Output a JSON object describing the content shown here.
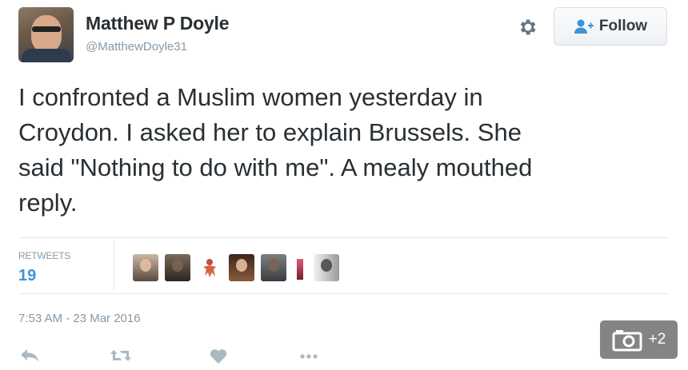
{
  "user": {
    "name": "Matthew P Doyle",
    "handle": "@MatthewDoyle31"
  },
  "follow_button": {
    "label": "Follow",
    "icon": "add-user-icon"
  },
  "tweet": {
    "text_lines": [
      "I confronted a Muslim women yesterday in",
      "Croydon. I asked her to explain Brussels. She",
      "said \"Nothing to do with me\". A mealy mouthed",
      "reply."
    ]
  },
  "stats": {
    "retweets_label": "RETWEETS",
    "retweets_count": "19"
  },
  "timestamp": "7:53 AM - 23 Mar 2016",
  "actions": [
    "reply-icon",
    "retweet-icon",
    "heart-icon",
    "more-icon"
  ],
  "photo_badge": {
    "icon": "camera-icon",
    "count": "+2"
  },
  "colors": {
    "text": "#292f33",
    "muted": "#8899a6",
    "link_blue": "#3b94d9",
    "action_grey": "#aab8c2"
  }
}
